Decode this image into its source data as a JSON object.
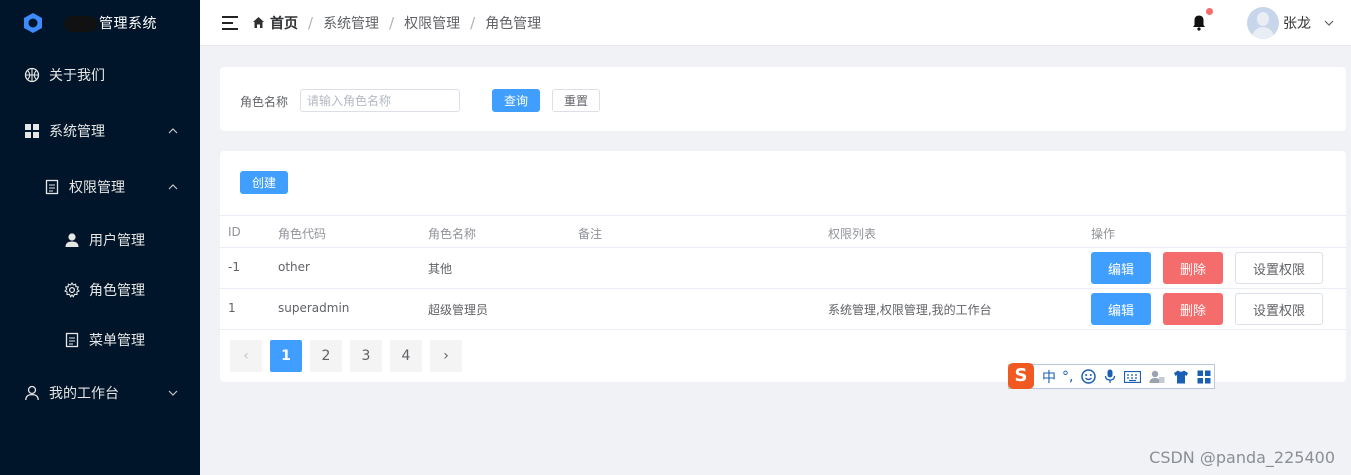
{
  "app": {
    "title": "管理系统"
  },
  "sidebar": {
    "items": [
      {
        "label": "关于我们",
        "icon": "basketball-icon"
      },
      {
        "label": "系统管理",
        "icon": "grid-icon",
        "expanded": true
      },
      {
        "label": "权限管理",
        "icon": "document-icon",
        "expanded": true
      },
      {
        "label": "用户管理",
        "icon": "user-icon"
      },
      {
        "label": "角色管理",
        "icon": "gear-icon",
        "active": true
      },
      {
        "label": "菜单管理",
        "icon": "document-icon"
      },
      {
        "label": "我的工作台",
        "icon": "person-outline-icon",
        "expanded": false
      }
    ]
  },
  "header": {
    "breadcrumb": [
      "首页",
      "系统管理",
      "权限管理",
      "角色管理"
    ],
    "username": "张龙",
    "has_notification": true
  },
  "search": {
    "label": "角色名称",
    "placeholder": "请输入角色名称",
    "query_label": "查询",
    "reset_label": "重置"
  },
  "table": {
    "create_label": "创建",
    "columns": [
      "ID",
      "角色代码",
      "角色名称",
      "备注",
      "权限列表",
      "操作"
    ],
    "rows": [
      {
        "id": "-1",
        "code": "other",
        "name": "其他",
        "remark": "",
        "permissions": ""
      },
      {
        "id": "1",
        "code": "superadmin",
        "name": "超级管理员",
        "remark": "",
        "permissions": "系统管理,权限管理,我的工作台"
      }
    ],
    "actions": {
      "edit": "编辑",
      "delete": "删除",
      "set_permission": "设置权限"
    }
  },
  "pagination": {
    "pages": [
      "1",
      "2",
      "3",
      "4"
    ],
    "current": "1",
    "prev_symbol": "‹",
    "next_symbol": "›"
  },
  "ime_toolbar": {
    "logo": "S",
    "mode": "中",
    "punct": "°,"
  },
  "watermark": "CSDN @panda_225400",
  "colors": {
    "sidebar_bg": "#001529",
    "primary": "#409eff",
    "danger": "#f56c6c",
    "page_bg": "#f0f2f5"
  }
}
